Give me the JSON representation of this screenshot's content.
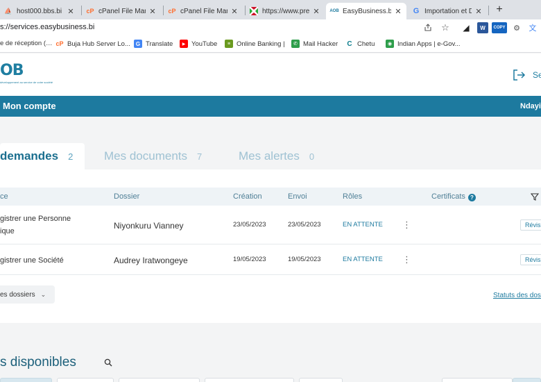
{
  "browser": {
    "tabs": [
      {
        "label": "host000.bbs.bi / l",
        "icon": "pma-icon"
      },
      {
        "label": "cPanel File Mana",
        "icon": "cpanel-icon"
      },
      {
        "label": "cPanel File Mana",
        "icon": "cpanel-icon"
      },
      {
        "label": "https://www.pres",
        "icon": "flag-icon"
      },
      {
        "label": "EasyBusiness.bi",
        "icon": "easybusiness-icon"
      },
      {
        "label": "Importation et D",
        "icon": "google-icon"
      }
    ],
    "active_tab": 4,
    "close_glyph": "✕",
    "new_tab_glyph": "+",
    "url": "s://services.easybusiness.bi",
    "bookmarks": [
      {
        "label": "e de réception (…",
        "icon": "mail-icon"
      },
      {
        "label": "Buja Hub Server Lo...",
        "icon": "cpanel-icon"
      },
      {
        "label": "Translate",
        "icon": "translate-icon"
      },
      {
        "label": "YouTube",
        "icon": "youtube-icon"
      },
      {
        "label": "Online Banking |",
        "icon": "bank-icon"
      },
      {
        "label": "Mail Hacker",
        "icon": "phone-icon"
      },
      {
        "label": "Chetu",
        "icon": "chetu-icon"
      },
      {
        "label": "Indian Apps | e-Gov...",
        "icon": "india-icon"
      }
    ],
    "ext_copy": "COPY",
    "ext_w": "W"
  },
  "header": {
    "logo_text": "OB",
    "logo_sub": "développement au service de votre société",
    "signout_label": "Se"
  },
  "banner": {
    "title": "Mon compte",
    "user": "Ndayi"
  },
  "tabs": [
    {
      "label": "demandes",
      "count": "2",
      "active": true
    },
    {
      "label": "Mes documents",
      "count": "7",
      "active": false
    },
    {
      "label": "Mes alertes",
      "count": "0",
      "active": false
    }
  ],
  "table": {
    "headers": {
      "procedure": "ce",
      "dossier": "Dossier",
      "creation": "Création",
      "envoi": "Envoi",
      "roles": "Rôles",
      "certificats": "Certificats"
    },
    "rows": [
      {
        "procedure": "gistrer une Personne ique",
        "dossier": "Niyonkuru Vianney",
        "creation": "23/05/2023",
        "envoi": "23/05/2023",
        "role": "EN ATTENTE",
        "action": "Révisi"
      },
      {
        "procedure": "gistrer une Société",
        "dossier": "Audrey Iratwongeye",
        "creation": "19/05/2023",
        "envoi": "19/05/2023",
        "role": "EN ATTENTE",
        "action": "Révisi"
      }
    ],
    "dossiers_button": "es dossiers",
    "statuts_link": "Statuts des dos"
  },
  "available": {
    "title": "s disponibles"
  },
  "colors": {
    "brand": "#1d7a9f",
    "banner": "#1d7a9f"
  }
}
